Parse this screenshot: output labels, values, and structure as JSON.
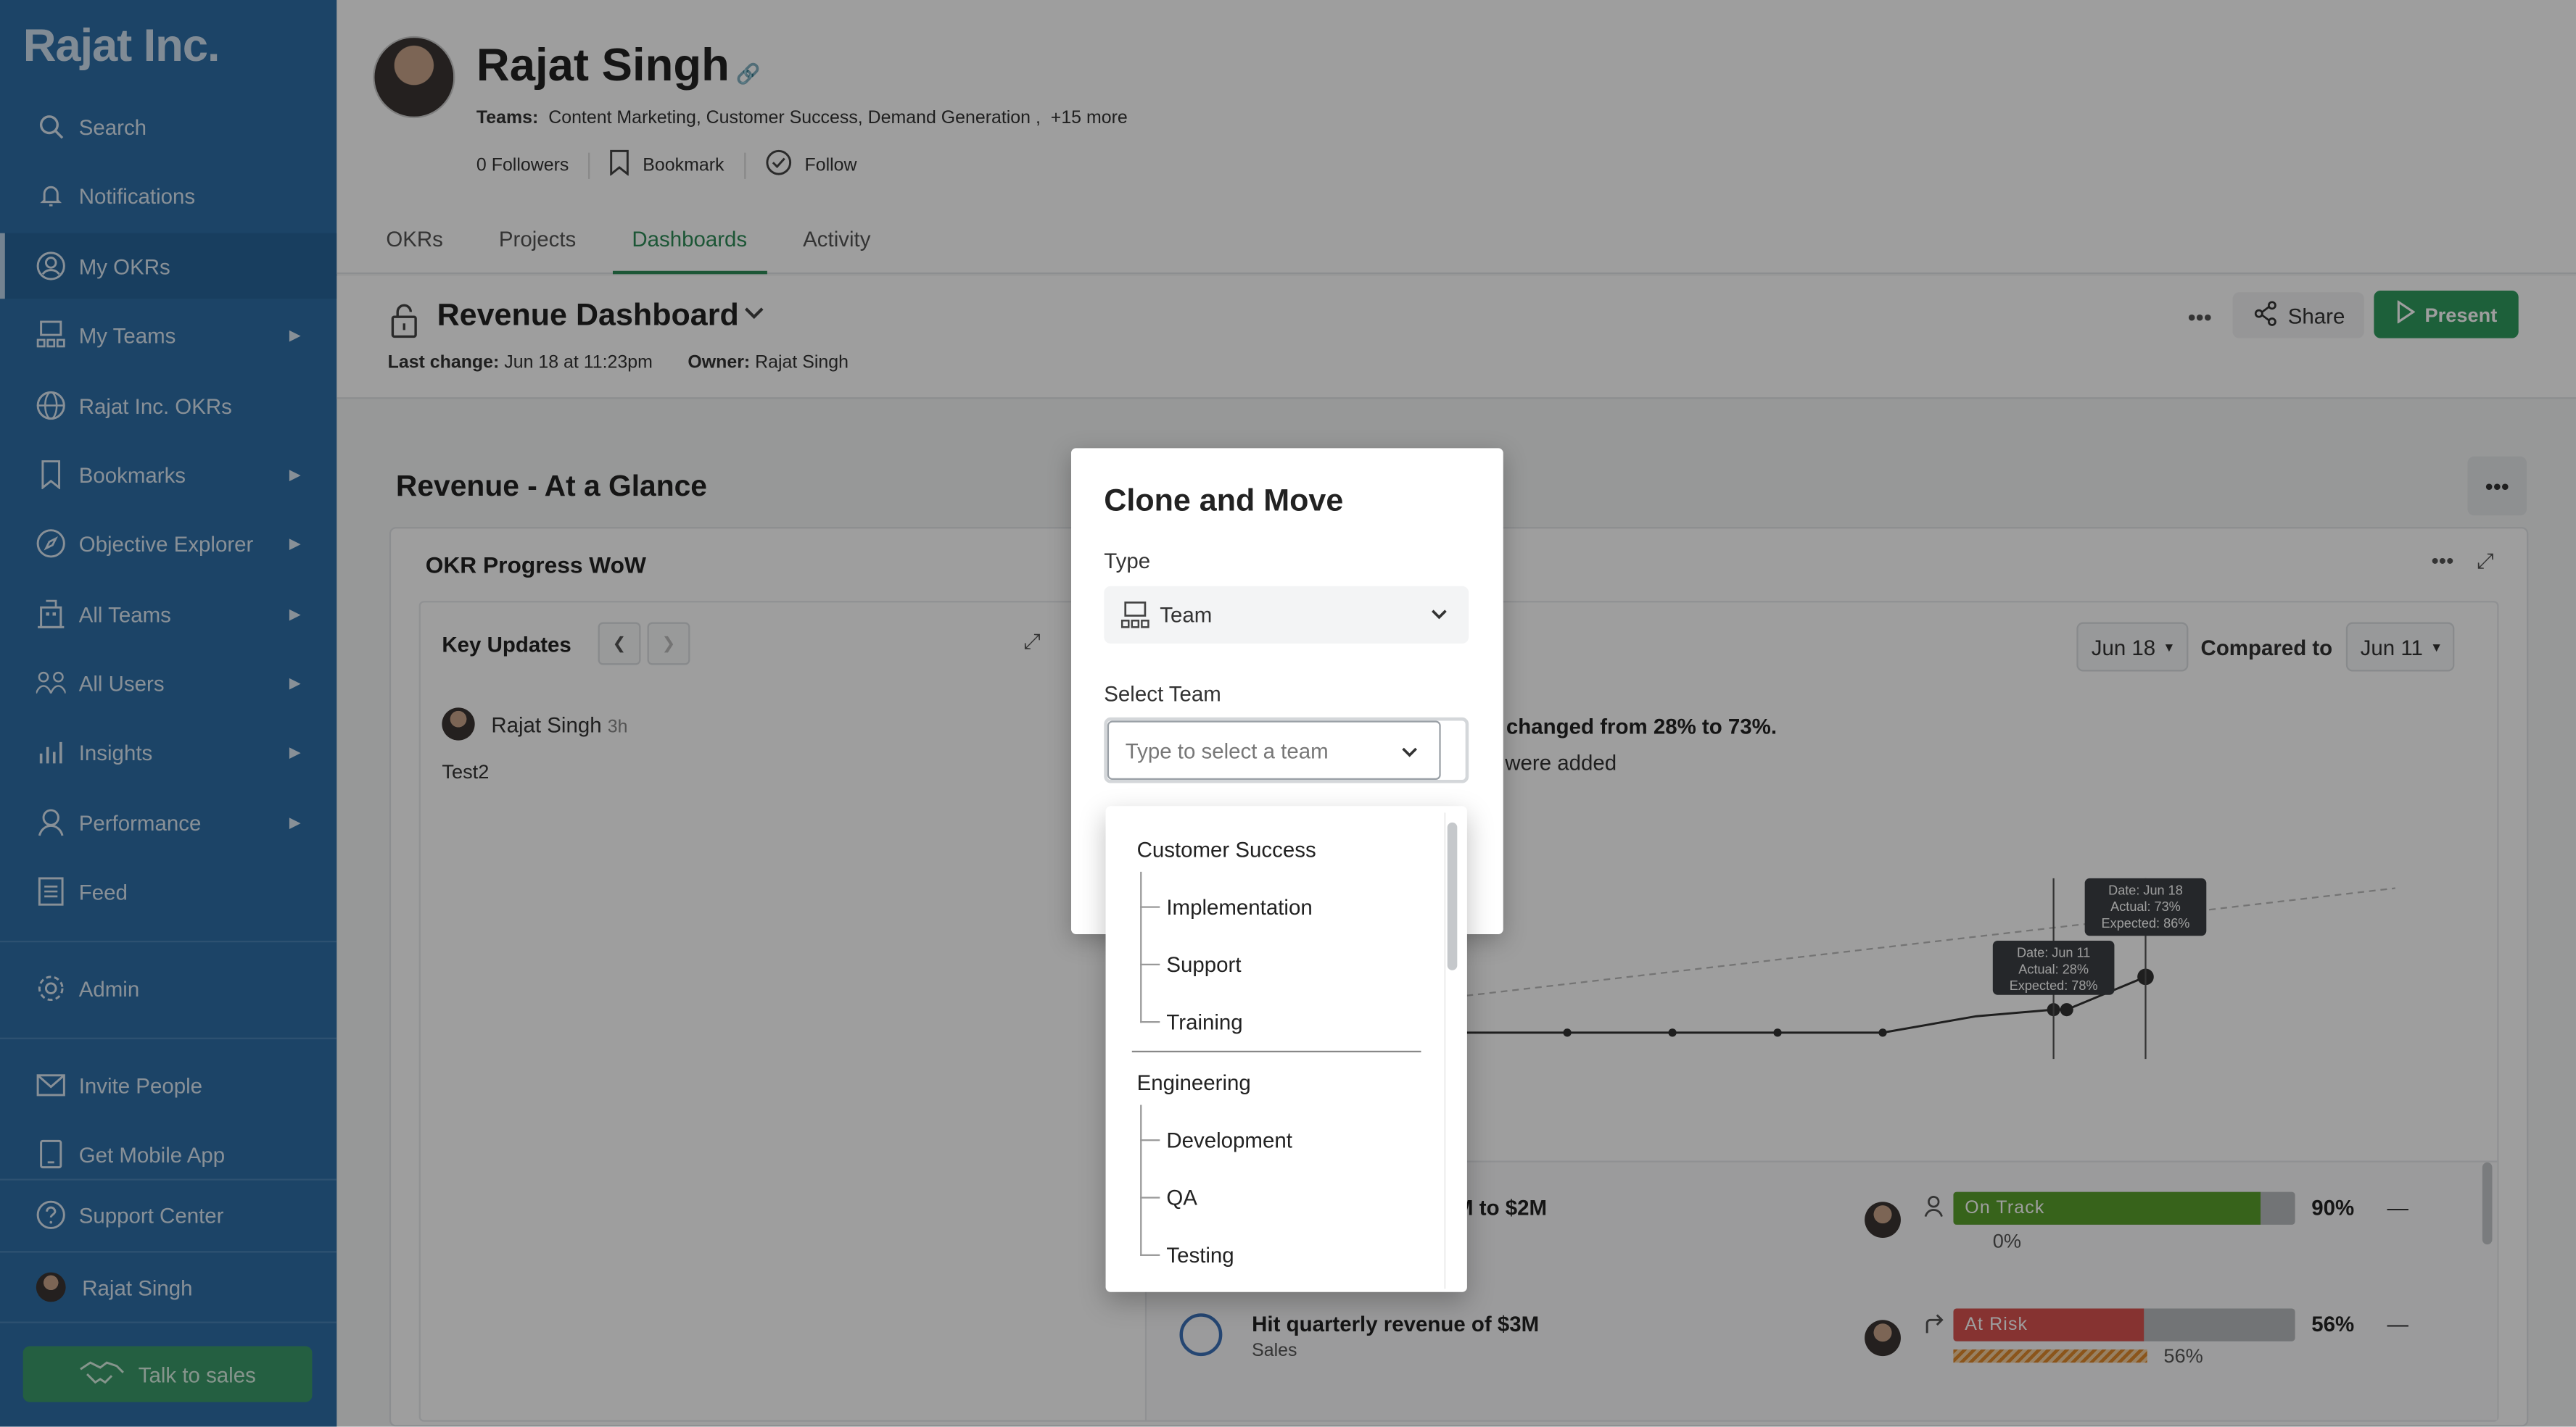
{
  "sidebar": {
    "brand": "Rajat Inc.",
    "items": [
      {
        "label": "Search",
        "icon": "search-icon"
      },
      {
        "label": "Notifications",
        "icon": "bell-icon"
      },
      {
        "label": "My OKRs",
        "icon": "user-circle-icon"
      },
      {
        "label": "My Teams",
        "icon": "team-icon"
      },
      {
        "label": "Rajat Inc. OKRs",
        "icon": "globe-icon"
      },
      {
        "label": "Bookmarks",
        "icon": "bookmark-icon"
      },
      {
        "label": "Objective Explorer",
        "icon": "compass-icon"
      },
      {
        "label": "All Teams",
        "icon": "building-icon"
      },
      {
        "label": "All Users",
        "icon": "users-icon"
      },
      {
        "label": "Insights",
        "icon": "chart-icon"
      },
      {
        "label": "Performance",
        "icon": "award-icon"
      },
      {
        "label": "Feed",
        "icon": "list-icon"
      },
      {
        "label": "Admin",
        "icon": "gear-icon"
      },
      {
        "label": "Invite People",
        "icon": "mail-icon"
      },
      {
        "label": "Get Mobile App",
        "icon": "mobile-icon"
      },
      {
        "label": "Support Center",
        "icon": "help-icon"
      },
      {
        "label": "Rajat Singh",
        "icon": "avatar"
      }
    ],
    "talk_to_sales": "Talk to sales"
  },
  "profile": {
    "name": "Rajat Singh",
    "teams_label": "Teams:",
    "teams": "Content Marketing, Customer Success, Demand Generation",
    "teams_more": "+15 more",
    "followers": "0 Followers",
    "bookmark": "Bookmark",
    "follow": "Follow"
  },
  "tabs": [
    "OKRs",
    "Projects",
    "Dashboards",
    "Activity"
  ],
  "active_tab": "Dashboards",
  "dashboard": {
    "title": "Revenue Dashboard",
    "last_change_label": "Last change:",
    "last_change": "Jun 18 at 11:23pm",
    "owner_label": "Owner:",
    "owner": "Rajat Singh",
    "share": "Share",
    "present": "Present"
  },
  "section": {
    "title": "Revenue - At a Glance",
    "card_title": "OKR Progress WoW",
    "key_updates": "Key Updates",
    "update_author": "Rajat Singh",
    "update_time": "3h",
    "update_text": "Test2",
    "date_current": "Jun 18",
    "compared_to": "Compared to",
    "date_compare": "Jun 11",
    "changed_text": "s changed from 28% to 73%.",
    "added_text": "s were added"
  },
  "chart_data": {
    "type": "line",
    "tooltips": [
      {
        "date": "Date: Jun 18",
        "actual": "Actual: 73%",
        "expected": "Expected: 86%"
      },
      {
        "date": "Date: Jun 11",
        "actual": "Actual: 28%",
        "expected": "Expected: 78%"
      }
    ]
  },
  "goals": [
    {
      "title": "M to $2M",
      "status": "On Track",
      "status_color": "#5aa02c",
      "progress": 0.9,
      "percent": "90%",
      "sub_percent": "0%",
      "dash": "—"
    },
    {
      "title": "Hit quarterly revenue of $3M",
      "team": "Sales",
      "status": "At Risk",
      "status_color": "#d9534f",
      "progress": 0.56,
      "percent": "56%",
      "sub_percent": "56%",
      "dash": "—"
    }
  ],
  "modal": {
    "title": "Clone and Move",
    "type_label": "Type",
    "type_value": "Team",
    "select_team_label": "Select Team",
    "team_placeholder": "Type to select a team"
  },
  "dropdown": {
    "groups": [
      {
        "name": "Customer Success",
        "children": [
          "Implementation",
          "Support",
          "Training"
        ]
      },
      {
        "name": "Engineering",
        "children": [
          "Development",
          "QA",
          "Testing"
        ]
      }
    ]
  }
}
